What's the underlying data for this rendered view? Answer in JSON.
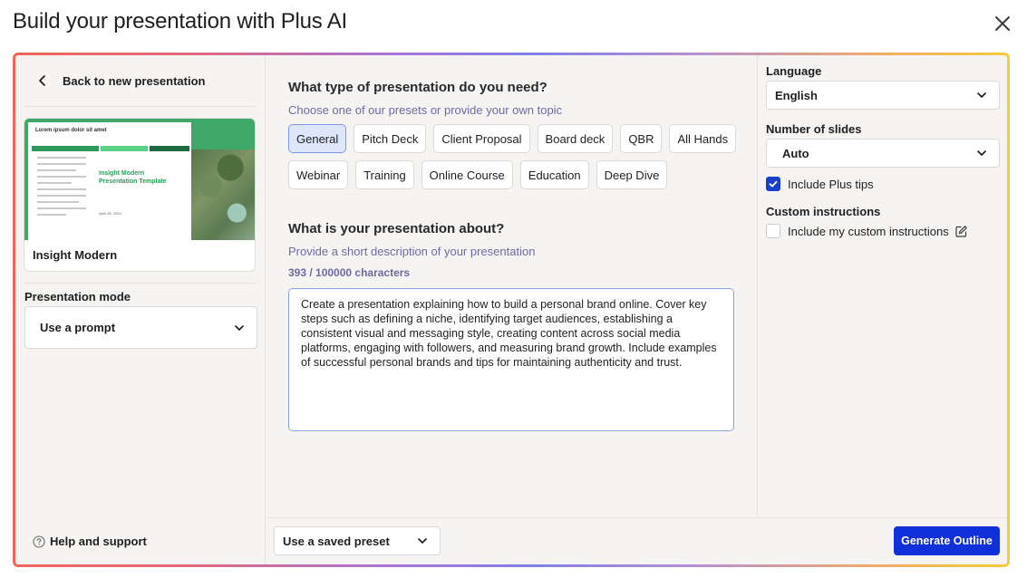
{
  "dialog": {
    "title": "Build your presentation with Plus AI",
    "close_icon": "close-icon"
  },
  "left": {
    "back_label": "Back to new presentation",
    "theme": {
      "name": "Insight Modern",
      "thumb_title": "Lorem ipsum dolor sit amet",
      "thumb_heading": "Insight Modern Presentation Template",
      "thumb_date": "April 28, 2024"
    },
    "mode_label": "Presentation mode",
    "mode_value": "Use a prompt",
    "help_label": "Help and support"
  },
  "center": {
    "type_question": "What type of presentation do you need?",
    "type_hint": "Choose one of our presets or provide your own topic",
    "presets": [
      "General",
      "Pitch Deck",
      "Client Proposal",
      "Board deck",
      "QBR",
      "All Hands",
      "Webinar",
      "Training",
      "Online Course",
      "Education",
      "Deep Dive"
    ],
    "active_preset": "General",
    "about_question": "What is your presentation about?",
    "about_hint": "Provide a short description of your presentation",
    "char_count": "393 / 100000 characters",
    "prompt_text": "Create a presentation explaining how to build a personal brand online. Cover key steps such as defining a niche, identifying target audiences, establishing a consistent visual and messaging style, creating content across social media platforms, engaging with followers, and measuring brand growth. Include examples of successful personal brands and tips for maintaining authenticity and trust."
  },
  "right": {
    "language_label": "Language",
    "language_value": "English",
    "slides_label": "Number of slides",
    "slides_value": "Auto",
    "plus_tips_label": "Include Plus tips",
    "plus_tips_checked": true,
    "custom_label": "Custom instructions",
    "custom_checkbox_label": "Include my custom instructions",
    "custom_checked": false
  },
  "footer": {
    "preset_select": "Use a saved preset",
    "generate_label": "Generate Outline"
  },
  "colors": {
    "accent": "#1230d9",
    "chip_active_bg": "#dde6fb",
    "hint_text": "#6d6aa0",
    "thumb_green": "#3fa868"
  }
}
